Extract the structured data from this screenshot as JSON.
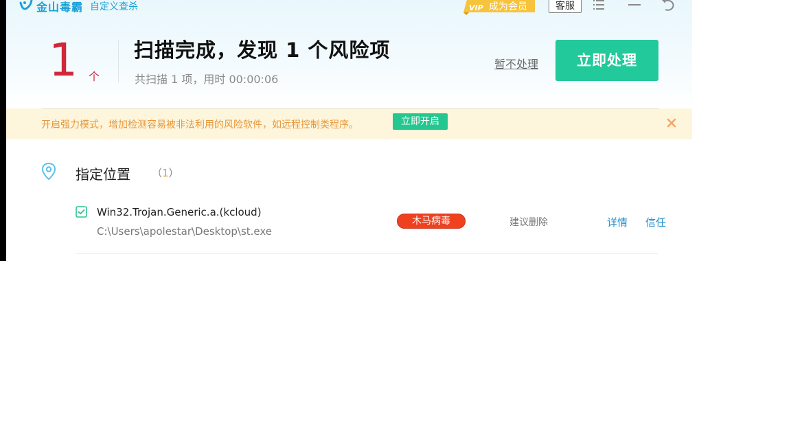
{
  "app": {
    "brand": "金山毒霸",
    "subtitle": "自定义查杀",
    "vip_label": "成为会员",
    "customer_service": "客服"
  },
  "summary": {
    "count": "1",
    "unit": "个",
    "title": "扫描完成，发现 1 个风险项",
    "detail": "共扫描 1 项，用时 00:00:06",
    "ignore_label": "暂不处理",
    "handle_label": "立即处理"
  },
  "notice": {
    "text": "开启强力模式，增加检测容易被非法利用的风险软件，如远程控制类程序。",
    "button": "立即开启"
  },
  "section": {
    "title": "指定位置",
    "count_open": "（",
    "count": "1",
    "count_close": "）"
  },
  "threats": [
    {
      "name": "Win32.Trojan.Generic.a.(kcloud)",
      "path": "C:\\Users\\apolestar\\Desktop\\st.exe",
      "type": "木马病毒",
      "suggestion": "建议删除",
      "detail_label": "详情",
      "trust_label": "信任",
      "checked": true
    }
  ],
  "colors": {
    "accent_green": "#22c99a",
    "danger_red": "#d0273a",
    "badge_red": "#f0411f",
    "link_blue": "#1e8fd0",
    "notice_orange": "#e8963a",
    "brand_blue": "#1aa0d8"
  },
  "icons": {
    "logo": "kingsoft-logo-icon",
    "menu": "menu-icon",
    "minimize": "minimize-icon",
    "back": "undo-icon",
    "close_notice": "close-icon",
    "location": "location-pin-icon",
    "checkbox": "checkbox-checked-icon"
  }
}
